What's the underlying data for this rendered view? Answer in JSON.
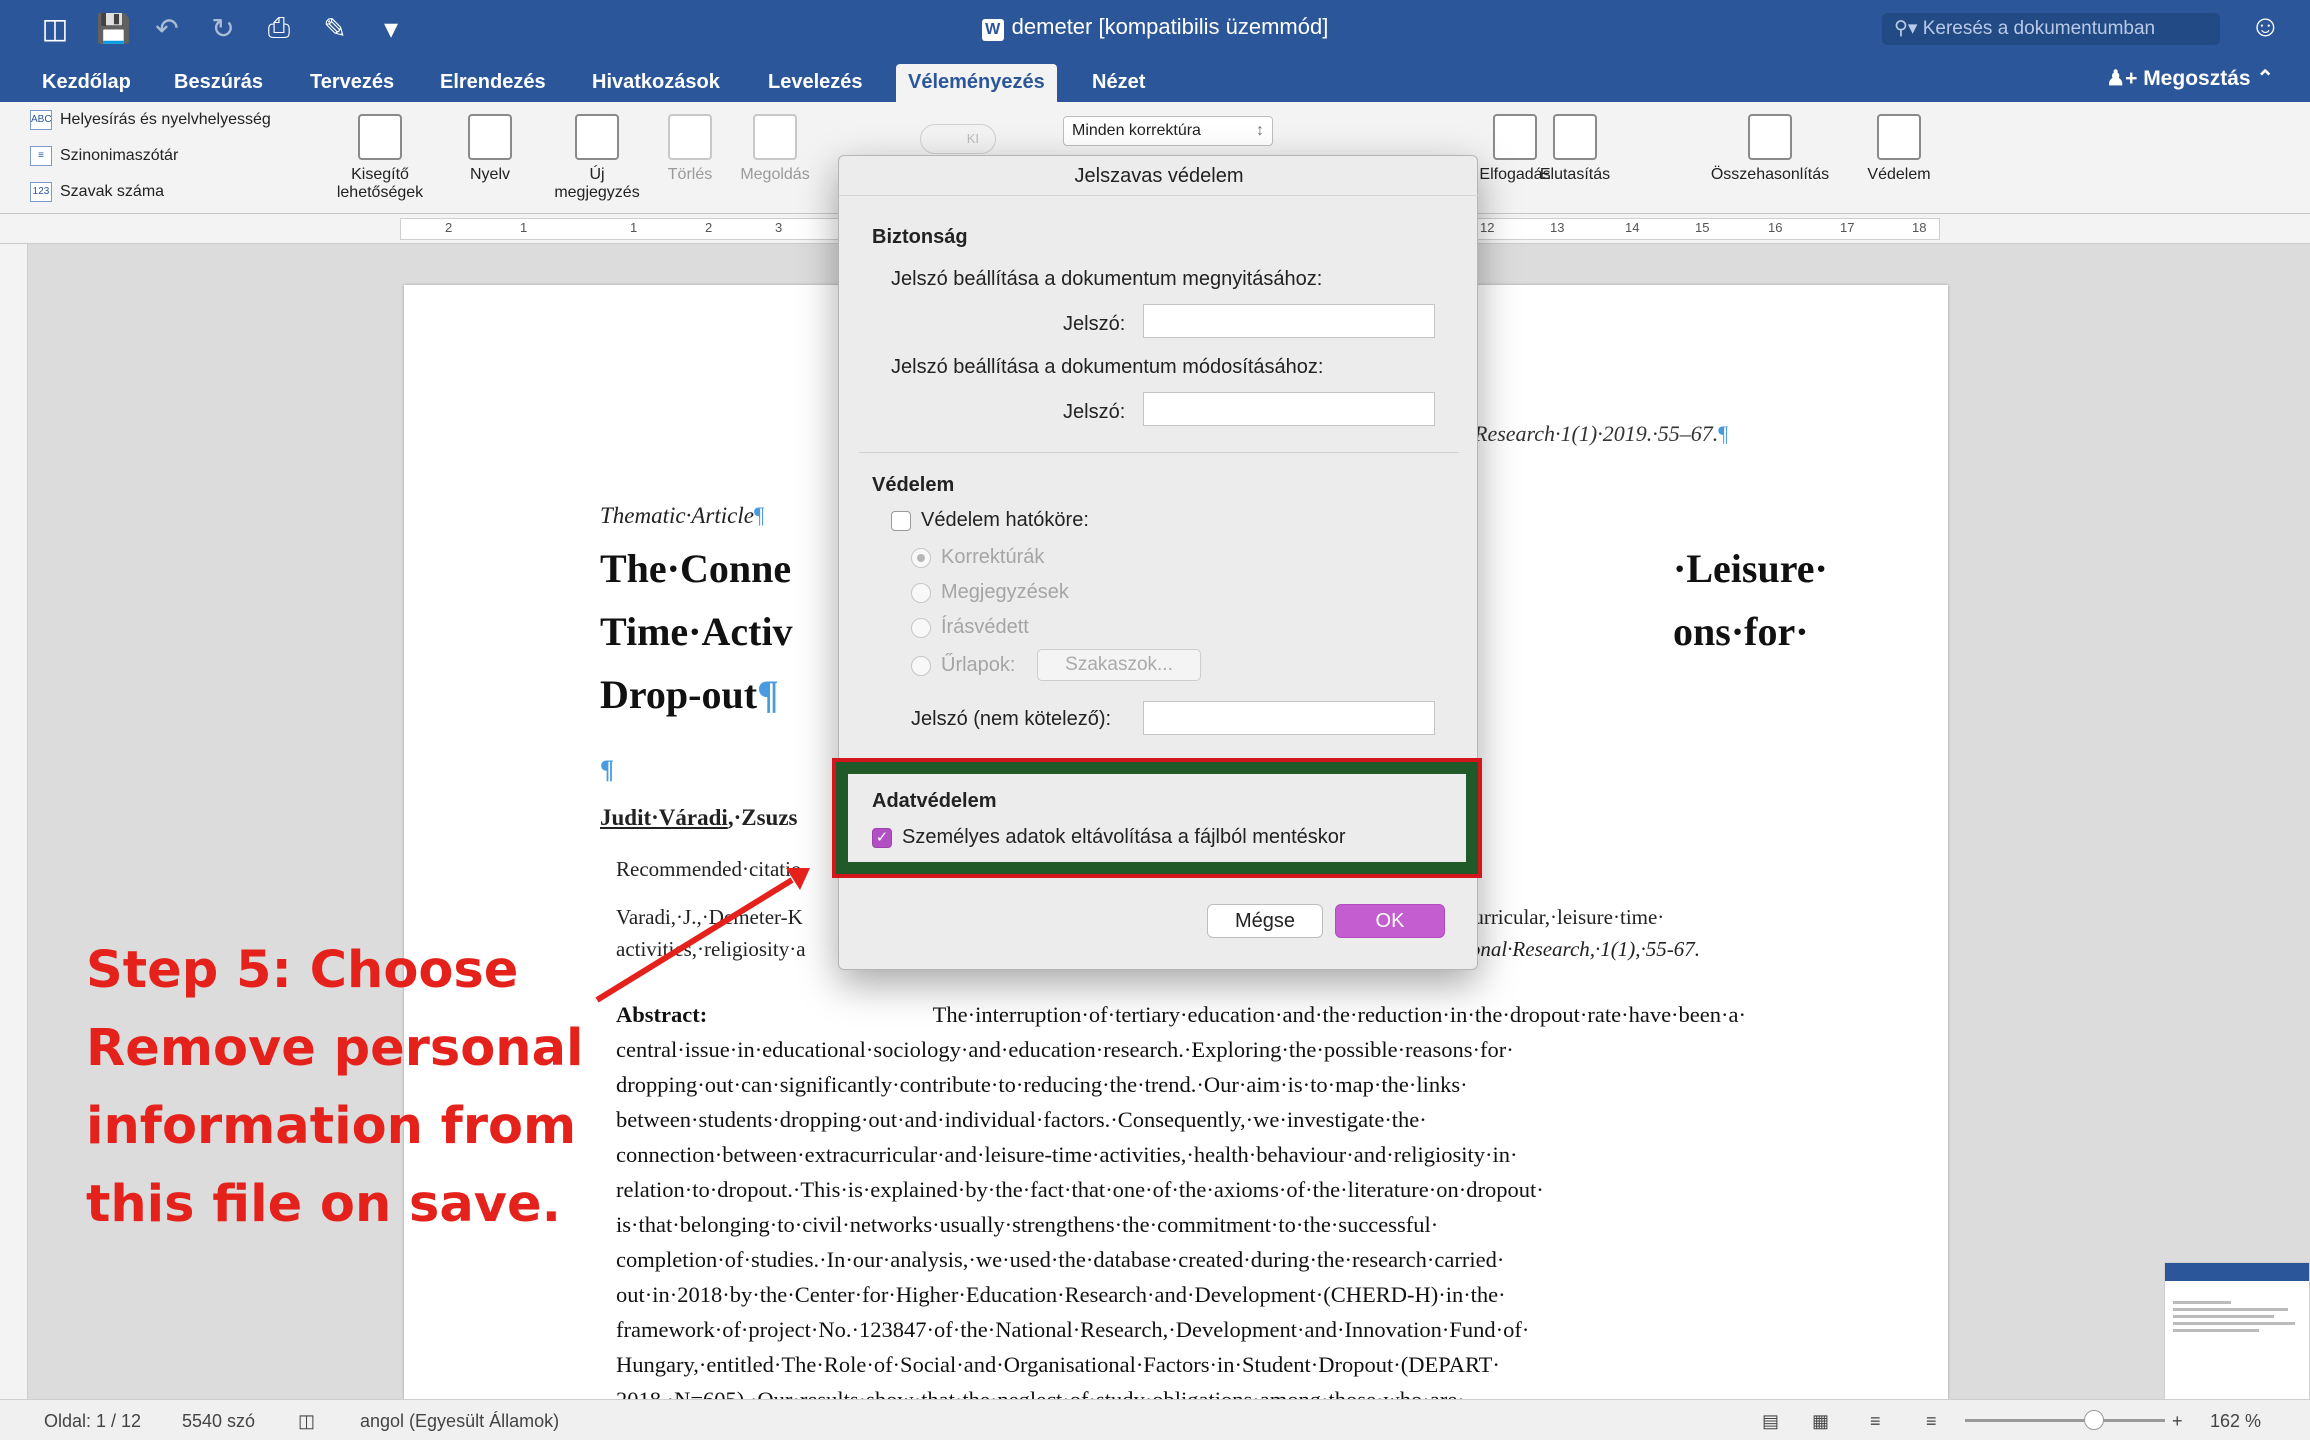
{
  "window": {
    "title": "demeter [kompatibilis üzemmód]",
    "search_placeholder": "Keresés a dokumentumban",
    "share_label": "Megosztás"
  },
  "tabs": [
    {
      "label": "Kezdőlap"
    },
    {
      "label": "Beszúrás"
    },
    {
      "label": "Tervezés"
    },
    {
      "label": "Elrendezés"
    },
    {
      "label": "Hivatkozások"
    },
    {
      "label": "Levelezés"
    },
    {
      "label": "Véleményezés"
    },
    {
      "label": "Nézet"
    }
  ],
  "ribbon": {
    "spelling": "Helyesírás és nyelvhelyesség",
    "thesaurus": "Szinonimaszótár",
    "word_count": "Szavak száma",
    "accessibility_line1": "Kisegítő",
    "accessibility_line2": "lehetőségek",
    "language": "Nyelv",
    "new_comment_line1": "Új",
    "new_comment_line2": "megjegyzés",
    "delete": "Törlés",
    "resolve": "Megoldás",
    "toggle_label": "KI",
    "markup_select": "Minden korrektúra",
    "accept": "Elfogadás",
    "reject": "Elutasítás",
    "compare": "Összehasonlítás",
    "protect": "Védelem"
  },
  "ruler": {
    "numbers": [
      "2",
      "1",
      "1",
      "2",
      "3",
      "12",
      "13",
      "14",
      "15",
      "16",
      "17",
      "18"
    ]
  },
  "dialog": {
    "title": "Jelszavas védelem",
    "security_heading": "Biztonság",
    "open_password_label": "Jelszó beállítása a dokumentum megnyitásához:",
    "password_label": "Jelszó:",
    "modify_password_label": "Jelszó beállítása a dokumentum módosításához:",
    "protection_heading": "Védelem",
    "protection_scope": "Védelem hatóköre:",
    "opt_tracked": "Korrektúrák",
    "opt_comments": "Megjegyzések",
    "opt_readonly": "Írásvédett",
    "opt_forms": "Űrlapok:",
    "sections_button": "Szakaszok...",
    "optional_password": "Jelszó (nem kötelező):",
    "privacy_heading": "Adatvédelem",
    "remove_personal": "Személyes adatok eltávolítása a fájlból mentéskor",
    "cancel": "Mégse",
    "ok": "OK"
  },
  "document": {
    "header_ref": "Research·1(1)·2019.·55–67.",
    "thematic": "Thematic·Article",
    "title_line1": "The·Conne",
    "title_line1_right": "·Leisure·",
    "title_line2": "Time·Activ",
    "title_line2_right": "ons·for·",
    "title_line3": "Drop-out",
    "authors": "Judit·Váradi",
    "authors_rest": ",·Zsuzs",
    "recommended": "Recommended·citatio",
    "cite_line1": "Varadi,·J.,·Demeter-K",
    "cite_line2": "activities,·religiosity·a",
    "cite_right1": "curricular,·leisure·time·",
    "cite_right2": "ional·Research,·1(1),·55-67.",
    "pilcrow": "¶",
    "abstract_label": "Abstract:",
    "abstract_text": "The·interruption·of·tertiary·education·and·the·reduction·in·the·dropout·rate·have·been·a· central·issue·in·educational·sociology·and·education·research.·Exploring·the·possible·reasons·for· dropping·out·can·significantly·contribute·to·reducing·the·trend.·Our·aim·is·to·map·the·links· between·students·dropping·out·and·individual·factors.·Consequently,·we·investigate·the· connection·between·extracurricular·and·leisure-time·activities,·health·behaviour·and·religiosity·in· relation·to·dropout.·This·is·explained·by·the·fact·that·one·of·the·axioms·of·the·literature·on·dropout· is·that·belonging·to·civil·networks·usually·strengthens·the·commitment·to·the·successful· completion·of·studies.·In·our·analysis,·we·used·the·database·created·during·the·research·carried· out·in·2018·by·the·Center·for·Higher·Education·Research·and·Development·(CHERD-H)·in·the· framework·of·project·No.·123847·of·the·National·Research,·Development·and·Innovation·Fund·of· Hungary,·entitled·The·Role·of·Social·and·Organisational·Factors·in·Student·Dropout·(DEPART· 2018,·N=605).·Our·results·show·that·the·neglect·of·study·obligations·among·those·who·are·"
  },
  "annotation": {
    "step_text": "Step 5: Choose Remove personal information from this file on save."
  },
  "status": {
    "page": "Oldal: 1 / 12",
    "words": "5540 szó",
    "language": "angol (Egyesült Államok)",
    "zoom": "162 %"
  },
  "colors": {
    "accent": "#2b579a",
    "annotation_red": "#e5211c",
    "highlight_green": "#1f5a28",
    "ok_purple": "#c35dd0"
  }
}
